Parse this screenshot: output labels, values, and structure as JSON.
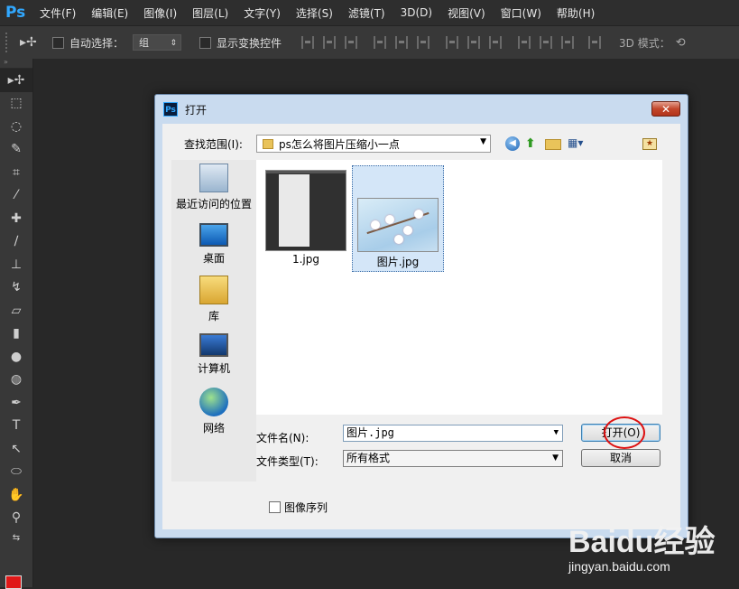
{
  "app": {
    "logo": "Ps",
    "menu": [
      "文件(F)",
      "编辑(E)",
      "图像(I)",
      "图层(L)",
      "文字(Y)",
      "选择(S)",
      "滤镜(T)",
      "3D(D)",
      "视图(V)",
      "窗口(W)",
      "帮助(H)"
    ]
  },
  "options": {
    "auto_select_label": "自动选择：",
    "auto_select_value": "组",
    "show_transform_label": "显示变换控件",
    "mode_label": "3D 模式："
  },
  "dialog": {
    "title": "打开",
    "close_glyph": "✕",
    "look_in_label": "查找范围(I):",
    "look_in_value": "ps怎么将图片压缩小一点",
    "places": [
      {
        "label": "最近访问的位置"
      },
      {
        "label": "桌面"
      },
      {
        "label": "库"
      },
      {
        "label": "计算机"
      },
      {
        "label": "网络"
      }
    ],
    "files": [
      {
        "name": "1.jpg",
        "selected": false
      },
      {
        "name": "图片.jpg",
        "selected": true
      }
    ],
    "filename_label": "文件名(N):",
    "filename_value": "图片.jpg",
    "filetype_label": "文件类型(T):",
    "filetype_value": "所有格式",
    "open_button": "打开(O)",
    "cancel_button": "取消",
    "sequence_label": "图像序列"
  },
  "watermark": {
    "logo": "Baidu经验",
    "url": "jingyan.baidu.com"
  },
  "colors": {
    "foreground": "#e01818",
    "accent": "#31a8ff"
  }
}
